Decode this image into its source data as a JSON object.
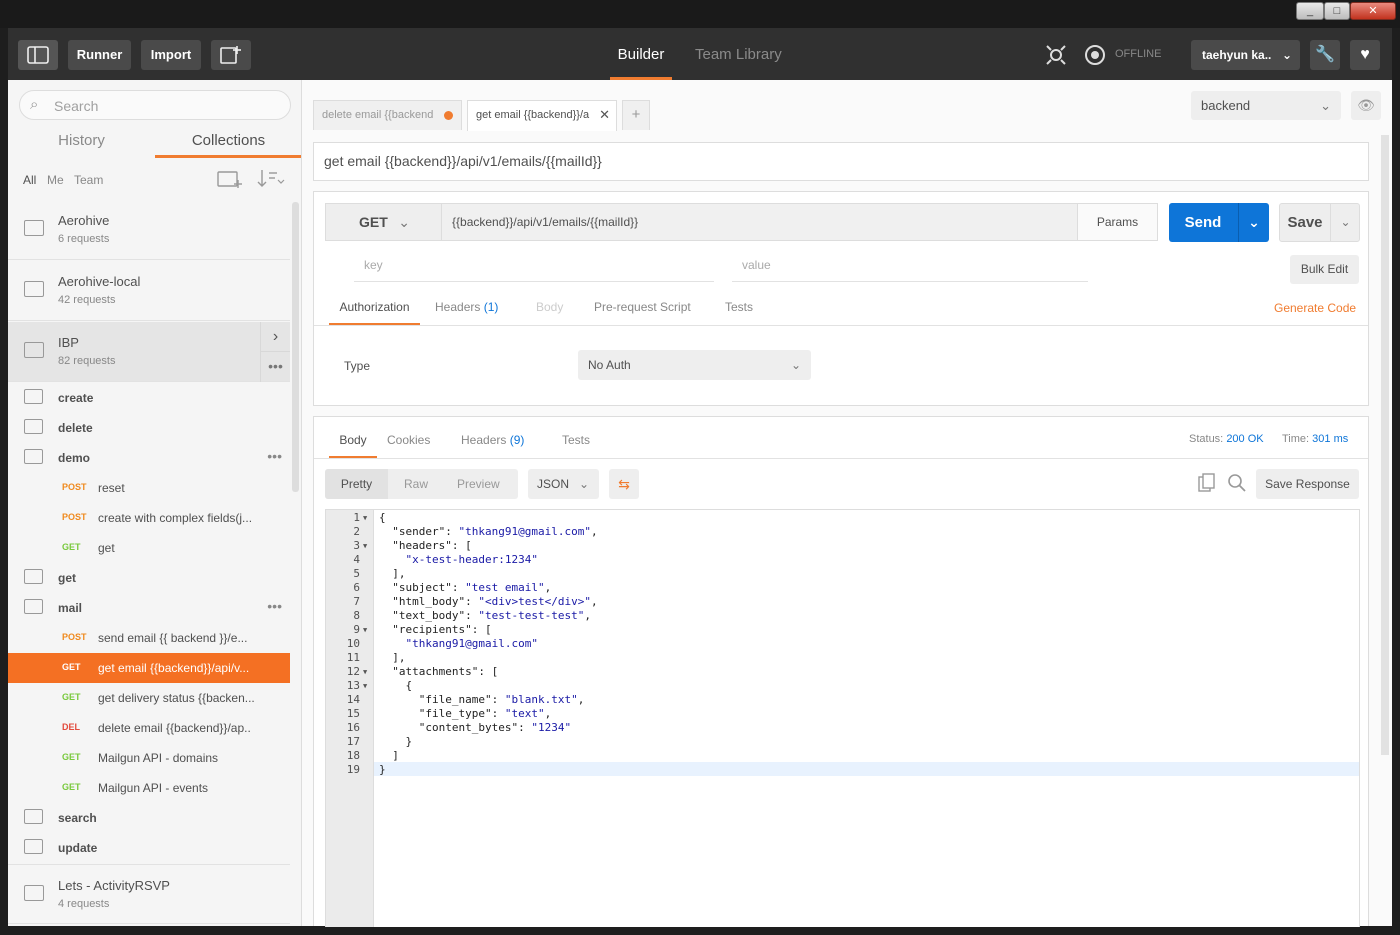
{
  "appbar": {
    "runner": "Runner",
    "import": "Import",
    "builder": "Builder",
    "team_library": "Team Library",
    "offline": "OFFLINE",
    "user": "taehyun ka.."
  },
  "sidebar": {
    "search_placeholder": "Search",
    "tabs": [
      "History",
      "Collections"
    ],
    "filters": [
      "All",
      "Me",
      "Team"
    ],
    "collections": [
      {
        "name": "Aerohive",
        "count": "6 requests"
      },
      {
        "name": "Aerohive-local",
        "count": "42 requests"
      },
      {
        "name": "IBP",
        "count": "82 requests"
      }
    ],
    "tree": [
      {
        "kind": "folder",
        "name": "create"
      },
      {
        "kind": "folder",
        "name": "delete"
      },
      {
        "kind": "folder",
        "name": "demo",
        "open": true
      },
      {
        "kind": "request",
        "method": "POST",
        "name": "reset"
      },
      {
        "kind": "request",
        "method": "POST",
        "name": "create with complex fields(j..."
      },
      {
        "kind": "request",
        "method": "GET",
        "name": "get"
      },
      {
        "kind": "folder",
        "name": "get"
      },
      {
        "kind": "folder",
        "name": "mail",
        "open": true
      },
      {
        "kind": "request",
        "method": "POST",
        "name": "send email {{ backend }}/e..."
      },
      {
        "kind": "request",
        "method": "GET",
        "name": "get email {{backend}}/api/v...",
        "selected": true
      },
      {
        "kind": "request",
        "method": "GET",
        "name": "get delivery status {{backen..."
      },
      {
        "kind": "request",
        "method": "DEL",
        "name": "delete email {{backend}}/ap.."
      },
      {
        "kind": "request",
        "method": "GET",
        "name": "Mailgun API - domains"
      },
      {
        "kind": "request",
        "method": "GET",
        "name": "Mailgun API - events"
      },
      {
        "kind": "folder",
        "name": "search"
      },
      {
        "kind": "folder",
        "name": "update"
      }
    ],
    "last_collection": {
      "name": "Lets - ActivityRSVP",
      "count": "4 requests"
    }
  },
  "tabs": {
    "tab1": "delete email {{backend",
    "tab2": "get email {{backend}}/a",
    "plus": "+"
  },
  "environment": "backend",
  "request": {
    "name": "get email {{backend}}/api/v1/emails/{{mailId}}",
    "method": "GET",
    "url": "{{backend}}/api/v1/emails/{{mailId}}",
    "params": "Params",
    "send": "Send",
    "save": "Save",
    "key_placeholder": "key",
    "value_placeholder": "value",
    "bulk_edit": "Bulk Edit",
    "subtabs": {
      "authorization": "Authorization",
      "headers": "Headers",
      "headers_count": "(1)",
      "body": "Body",
      "prerequest": "Pre-request Script",
      "tests": "Tests"
    },
    "generate_code": "Generate Code",
    "type_label": "Type",
    "auth_type": "No Auth"
  },
  "response": {
    "tabs": {
      "body": "Body",
      "cookies": "Cookies",
      "headers": "Headers",
      "headers_count": "(9)",
      "tests": "Tests"
    },
    "status_label": "Status:",
    "status": "200 OK",
    "time_label": "Time:",
    "time": "301 ms",
    "views": [
      "Pretty",
      "Raw",
      "Preview"
    ],
    "format": "JSON",
    "save_response": "Save Response",
    "lines": [
      "{",
      "  \"sender\": \"thkang91@gmail.com\",",
      "  \"headers\": [",
      "    \"x-test-header:1234\"",
      "  ],",
      "  \"subject\": \"test email\",",
      "  \"html_body\": \"<div>test</div>\",",
      "  \"text_body\": \"test-test-test\",",
      "  \"recipients\": [",
      "    \"thkang91@gmail.com\"",
      "  ],",
      "  \"attachments\": [",
      "    {",
      "      \"file_name\": \"blank.txt\",",
      "      \"file_type\": \"text\",",
      "      \"content_bytes\": \"1234\"",
      "    }",
      "  ]",
      "}"
    ],
    "fold_lines": [
      1,
      3,
      9,
      12,
      13
    ]
  },
  "colors": {
    "accent": "#f07c30",
    "send": "#0e75d8",
    "get": "#78c93c",
    "post": "#f08a1e",
    "del": "#e34a3c"
  }
}
